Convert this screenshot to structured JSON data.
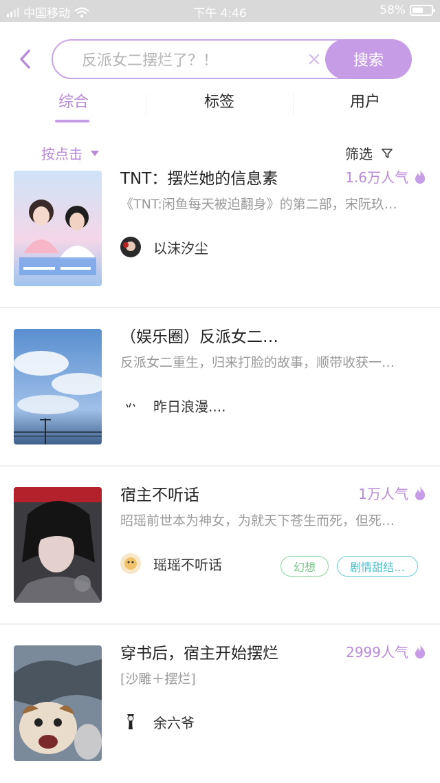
{
  "status_bar": {
    "carrier": "中国移动",
    "time": "下午 4:46",
    "battery_percent": "58%",
    "battery_level": 0.58
  },
  "search": {
    "query": "反派女二摆烂了？！",
    "button_label": "搜索"
  },
  "tabs": [
    {
      "label": "综合",
      "active": true
    },
    {
      "label": "标签",
      "active": false
    },
    {
      "label": "用户",
      "active": false
    }
  ],
  "sort": {
    "label": "按点击"
  },
  "filter": {
    "label": "筛选"
  },
  "results": [
    {
      "title": "TNT：摆烂她的信息素",
      "popularity": "1.6万人气",
      "desc": "《TNT:闲鱼每天被迫翻身》的第二部，宋阮玖…",
      "author": "以沫汐尘",
      "tags": [],
      "cover_text": "THE ADVENTURES OF CLOUDS"
    },
    {
      "title": "（娱乐圈）反派女二…",
      "popularity": "",
      "desc": "反派女二重生，归来打脸的故事，顺带收获一…",
      "author": "昨日浪漫....",
      "tags": []
    },
    {
      "title": "宿主不听话",
      "popularity": "1万人气",
      "desc": "昭瑶前世本为神女，为就天下苍生而死，但死…",
      "author": "瑶瑶不听话",
      "tags": [
        "幻想",
        "剧情甜结…"
      ]
    },
    {
      "title": "穿书后，宿主开始摆烂",
      "popularity": "2999人气",
      "desc": "[沙雕＋摆烂]",
      "author": "余六爷",
      "tags": []
    }
  ],
  "colors": {
    "accent": "#c79ce6",
    "accent_text": "#b98ad8",
    "tag_green": "#77c58b",
    "tag_teal": "#4fbfcc"
  },
  "icons": {
    "back": "back-chevron-icon",
    "clear": "clear-x-icon",
    "sort_caret": "caret-down-icon",
    "filter": "filter-funnel-icon",
    "popularity": "flame-icon",
    "wifi": "wifi-icon",
    "signal": "signal-icon",
    "battery": "battery-icon"
  }
}
